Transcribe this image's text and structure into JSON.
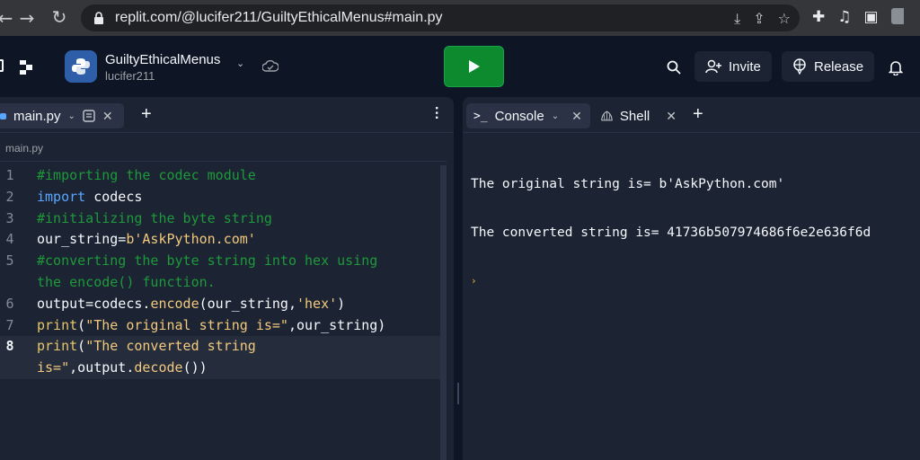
{
  "browser": {
    "url": "replit.com/@lucifer211/GuiltyEthicalMenus#main.py"
  },
  "header": {
    "repl_name": "GuiltyEthicalMenus",
    "owner": "lucifer211",
    "invite_label": "Invite",
    "release_label": "Release"
  },
  "editor": {
    "tab_label": "main.py",
    "breadcrumb": "main.py",
    "lines": [
      {
        "num": "1",
        "parts": [
          {
            "t": "#importing the codec module",
            "c": "cm"
          }
        ]
      },
      {
        "num": "2",
        "parts": [
          {
            "t": "import",
            "c": "kw"
          },
          {
            "t": " codecs",
            "c": ""
          }
        ]
      },
      {
        "num": "3",
        "parts": [
          {
            "t": "#initializing the byte string",
            "c": "cm"
          }
        ]
      },
      {
        "num": "4",
        "parts": [
          {
            "t": "our_string=",
            "c": ""
          },
          {
            "t": "b'AskPython.com'",
            "c": "st"
          }
        ]
      },
      {
        "num": "5",
        "parts": [
          {
            "t": "#converting the byte string into hex using",
            "c": "cm"
          }
        ]
      },
      {
        "num": "",
        "parts": [
          {
            "t": "the encode() function.",
            "c": "cm"
          }
        ]
      },
      {
        "num": "6",
        "parts": [
          {
            "t": "output=codecs.",
            "c": ""
          },
          {
            "t": "encode",
            "c": "mt"
          },
          {
            "t": "(our_string,",
            "c": ""
          },
          {
            "t": "'hex'",
            "c": "st"
          },
          {
            "t": ")",
            "c": ""
          }
        ]
      },
      {
        "num": "7",
        "parts": [
          {
            "t": "print",
            "c": "fn"
          },
          {
            "t": "(",
            "c": ""
          },
          {
            "t": "\"The original string is=\"",
            "c": "st"
          },
          {
            "t": ",our_string)",
            "c": ""
          }
        ]
      },
      {
        "num": "8",
        "active": true,
        "parts": [
          {
            "t": "print",
            "c": "fn"
          },
          {
            "t": "(",
            "c": ""
          },
          {
            "t": "\"The converted string",
            "c": "st"
          }
        ]
      },
      {
        "num": "",
        "active": true,
        "parts": [
          {
            "t": "is=\"",
            "c": "st"
          },
          {
            "t": ",output.",
            "c": ""
          },
          {
            "t": "decode",
            "c": "mt"
          },
          {
            "t": "())",
            "c": ""
          }
        ]
      }
    ]
  },
  "console": {
    "tab_console": "Console",
    "tab_shell": "Shell",
    "output_lines": [
      "The original string is= b'AskPython.com'",
      "The converted string is= 41736b507974686f6e2e636f6d"
    ]
  },
  "colors": {
    "run_button": "#0e8a2e",
    "background": "#0e1525",
    "panel": "#1c2333"
  }
}
